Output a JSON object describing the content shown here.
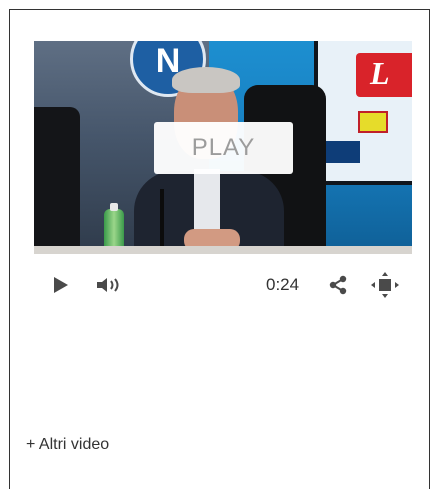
{
  "player": {
    "overlay_label": "PLAY",
    "duration": "0:24",
    "icons": {
      "play": "play-icon",
      "volume": "volume-icon",
      "share": "share-icon",
      "fullscreen": "fullscreen-icon"
    },
    "video_logo_letter": "N",
    "video_sponsor_letter": "L"
  },
  "footer": {
    "more_videos": "+ Altri video"
  }
}
